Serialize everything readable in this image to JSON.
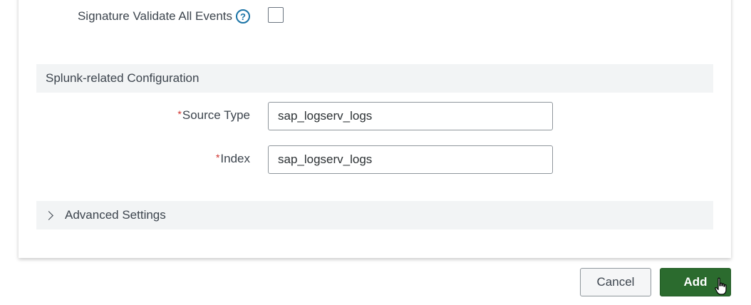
{
  "signature": {
    "label": "Signature Validate All Events",
    "help_icon": "?",
    "checked": false
  },
  "splunk_section": {
    "title": "Splunk-related Configuration",
    "required_marker": "*",
    "source_type": {
      "label": "Source Type",
      "value": "sap_logserv_logs"
    },
    "index": {
      "label": "Index",
      "value": "sap_logserv_logs"
    }
  },
  "advanced": {
    "title": "Advanced Settings",
    "icon": "chevron-right-icon"
  },
  "footer": {
    "cancel_label": "Cancel",
    "add_label": "Add"
  },
  "colors": {
    "primary_button": "#2b6b2e",
    "help_icon": "#1a73a6",
    "required": "#d0312d",
    "section_bg": "#f2f4f5"
  }
}
